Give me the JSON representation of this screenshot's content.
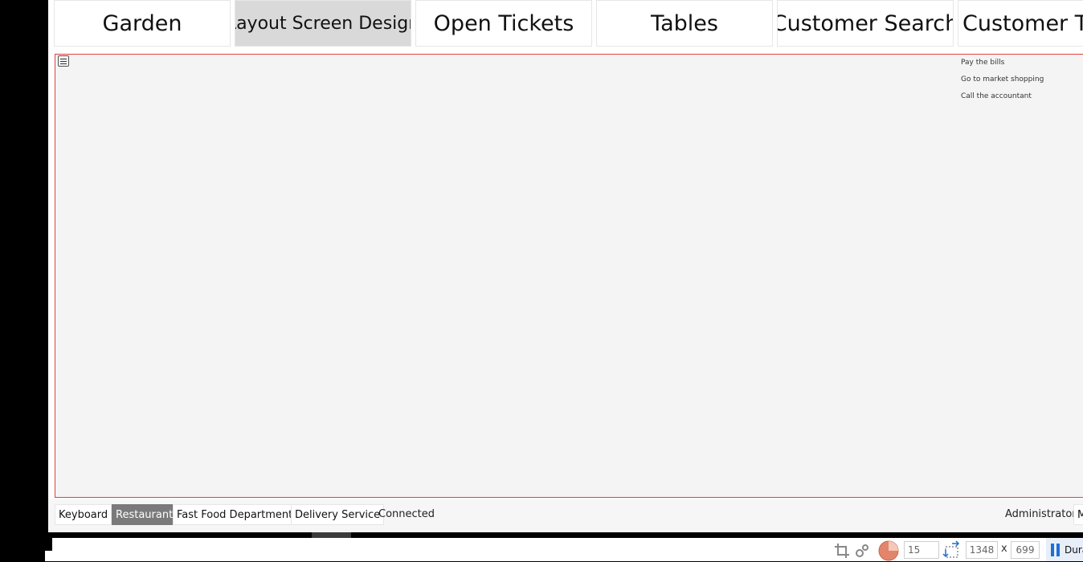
{
  "nav": {
    "items": [
      {
        "label": "Garden"
      },
      {
        "label": "Layout Screen Design"
      },
      {
        "label": "Open Tickets"
      },
      {
        "label": "Tables"
      },
      {
        "label": "Customer Search"
      },
      {
        "label": "Customer Ti"
      }
    ],
    "active_index": 1
  },
  "canvas": {
    "tasks": [
      "Pay the bills",
      "Go to market shopping",
      "Call the accountant"
    ]
  },
  "status_bar": {
    "departments": [
      "Keyboard",
      "Restaurant",
      "Fast Food Department",
      "Delivery Service"
    ],
    "active_department": "Restaurant",
    "connection": "Connected",
    "user": "Administrator",
    "cut_off_button": "M"
  },
  "taskbar": {
    "value": "15",
    "width": "1348",
    "times": "x",
    "height": "699",
    "app_label": "Dura"
  },
  "colors": {
    "canvas_border": "#e34040",
    "active_department": "#7a7a7a",
    "active_nav": "#d9d9d9",
    "timer_accent": "#e2856a"
  }
}
